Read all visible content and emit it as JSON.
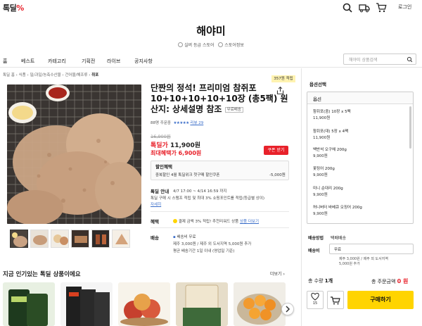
{
  "header": {
    "logo_text": "톡딜",
    "logo_mark": "%",
    "icons": [
      "search-icon",
      "truck-icon",
      "cart-icon"
    ],
    "login_label": "로그인"
  },
  "store": {
    "name": "해야미",
    "grade_label": "실버 등급 스토어",
    "info_label": "스토어정보"
  },
  "nav": {
    "items": [
      "홈",
      "베스트",
      "카테고리",
      "기획전",
      "라이브",
      "공지사항"
    ],
    "search_placeholder": "해야미 상품검색"
  },
  "breadcrumb": {
    "path": "톡딜 홈 › 식품 › 밀/과일/농축수산물 › 건어물/해조류 ›",
    "current": "쥐포"
  },
  "product": {
    "review_badge": "357원 적립",
    "title": "단짠의 정석! 프리미엄 참쥐포 10+10+10+10+10장 (총5팩) 원산지: 상세설명 참조",
    "free_ship_tag": "무료배송",
    "orders": "88명 주문중",
    "stars": "★★★★★",
    "review_count": "리뷰 29",
    "original_price": "16,900원",
    "sale_label": "톡딜가",
    "sale_price": "11,900원",
    "best_label": "최대혜택가",
    "best_price": "6,900원",
    "coupon_label": "쿠폰 받기",
    "discount": {
      "title": "할인혜택",
      "desc": "중복할인  4월 톡딜위크 첫구매 할인쿠폰",
      "amount": "-5,000원"
    },
    "tokdeal": {
      "label": "톡딜 안내",
      "period": "4/7 17:00 ~ 4/14 16:59 까지",
      "line1": "톡딜 구매 시 스탬프 적립 및 최대 3% 쇼핑포인트를 적립(등급별 상이)",
      "detail_link": "자세히"
    },
    "benefit": {
      "label": "혜택",
      "text": "결제 금액 3% 적립! 추천리워드 상품",
      "link": "상품 더보기"
    },
    "shipping": {
      "label": "배송",
      "free": "배송비 무료",
      "line1": "제주 3,000원 / 제주 외 도서지역 5,000원 추가",
      "line2": "평균 배송기간 1일 이내 (영업일 기준)"
    }
  },
  "popular": {
    "title": "지금 인기있는 톡딜 상품이에요",
    "more_label": "더보기 ›"
  },
  "order_panel": {
    "options_header": "옵션선택",
    "select_label": "옵션",
    "options": [
      {
        "name": "참쥐포(중) 10장 x 5팩",
        "price": "11,900원"
      },
      {
        "name": "참쥐포(대) 5장 x 4팩",
        "price": "11,900원"
      },
      {
        "name": "백반석 오구채 200g",
        "price": "9,900원"
      },
      {
        "name": "꽃징어 200g",
        "price": "9,900원"
      },
      {
        "name": "미니 순대리 200g",
        "price": "9,900원"
      },
      {
        "name": "허니버터 바베큐 오징어 200g",
        "price": "9,900원"
      }
    ],
    "ship_method_label": "배송방법",
    "ship_method_value": "택배배송",
    "ship_fee_label": "배송비",
    "ship_fee_value": "무료",
    "ship_note_1": "제주 3,000원 / 제주 외 도서지역",
    "ship_note_2": "5,000원 추가",
    "qty_label": "총 수량",
    "qty_value": "1개",
    "total_label": "총 주문금액",
    "total_value": "0 원",
    "like_count": "15",
    "buy_label": "구매하기"
  },
  "colors": {
    "accent_red": "#e8212a",
    "buy_yellow": "#ffd400",
    "link_blue": "#3b6ec9"
  }
}
